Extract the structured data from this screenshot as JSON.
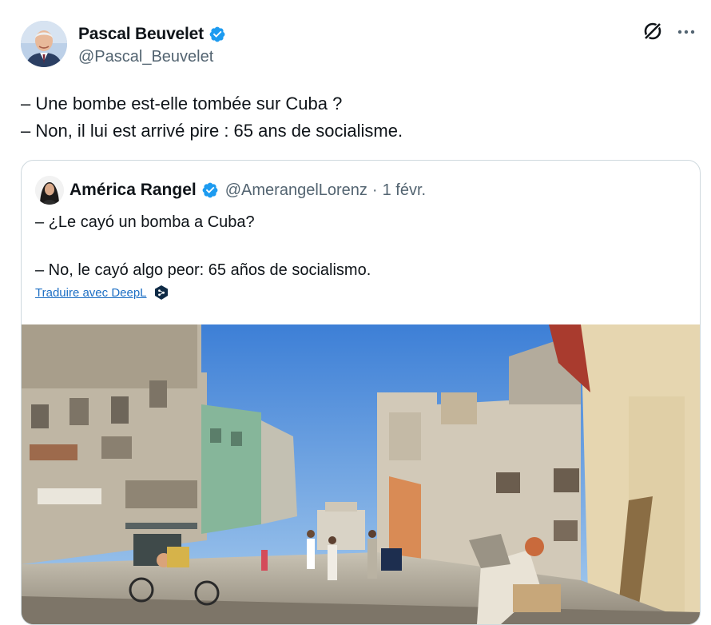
{
  "tweet": {
    "author_name": "Pascal Beuvelet",
    "author_handle": "@Pascal_Beuvelet",
    "text_lines": [
      "– Une bombe est-elle tombée sur Cuba ?",
      "– Non, il lui est arrivé pire : 65 ans de socialisme."
    ]
  },
  "quote": {
    "author_name": "América Rangel",
    "author_handle": "@AmerangelLorenz",
    "separator": "·",
    "time": "1 févr.",
    "text_lines": [
      "– ¿Le cayó un bomba a Cuba?",
      "– No, le cayó algo peor: 65 años de socialismo."
    ],
    "translate_label": "Traduire avec DeepL"
  },
  "icons": {
    "verified": "verified-badge-icon",
    "grok": "grok-icon",
    "more": "more-options-icon",
    "deepl": "deepl-icon"
  },
  "colors": {
    "verified_blue": "#1d9bf0",
    "link_blue": "#1d6fc4",
    "secondary_text": "#536471",
    "border": "#cfd9de"
  }
}
